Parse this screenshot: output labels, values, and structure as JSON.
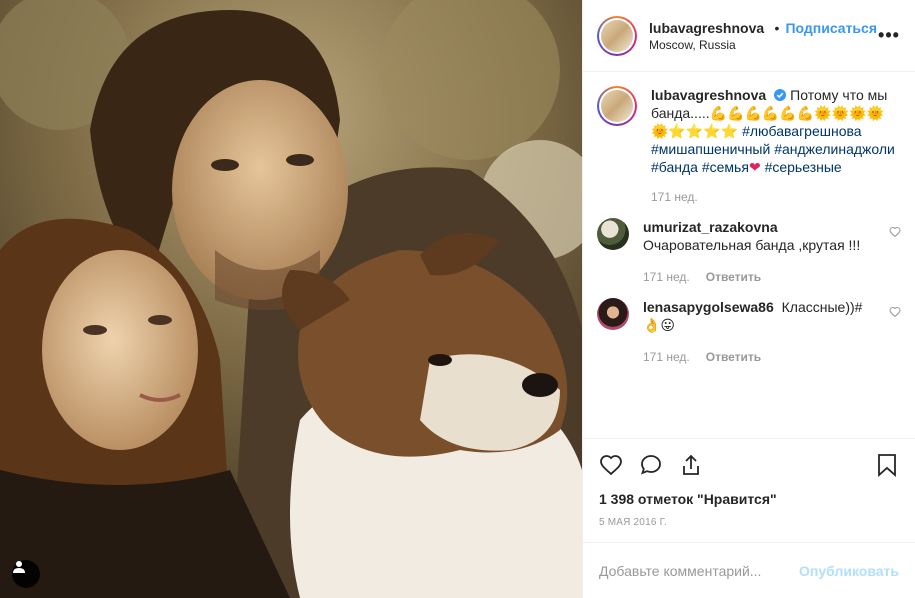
{
  "post": {
    "username": "lubavagreshnova",
    "location": "Moscow, Russia",
    "follow_label": "Подписаться",
    "dot": "•",
    "more": "•••"
  },
  "caption": {
    "username": "lubavagreshnova",
    "text_start": "Потому что мы банда.....💪💪💪💪💪💪🌞🌞🌞🌞🌞⭐⭐⭐⭐",
    "tags": [
      "#любавагрешнова",
      "#мишапшеничный",
      "#анджелинаджоли",
      "#банда",
      "#семья",
      "#серьезные"
    ],
    "heart": "❤",
    "time": "171 нед."
  },
  "comments": [
    {
      "username": "umurizat_razakovna",
      "text": "Очаровательная банда ,крутая !!!",
      "time": "171 нед.",
      "reply": "Ответить"
    },
    {
      "username": "lenasapygolsewa86",
      "text": "Классные))#👌😛",
      "time": "171 нед.",
      "reply": "Ответить"
    }
  ],
  "likes": "1 398 отметок \"Нравится\"",
  "date": "5 мая 2016 г.",
  "add_comment": {
    "placeholder": "Добавьте комментарий...",
    "publish": "Опубликовать"
  },
  "colors": {
    "link": "#3897f0",
    "hashtag": "#003569",
    "muted": "#999999",
    "publish_disabled": "#b2dffc"
  }
}
